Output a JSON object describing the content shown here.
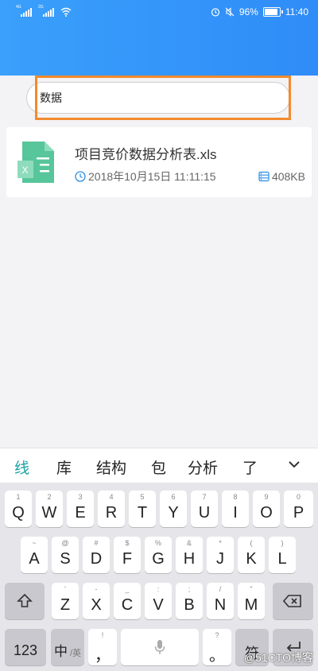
{
  "status_bar": {
    "net1": "4G",
    "net2": "2G",
    "battery": "96%",
    "time": "11:40"
  },
  "search": {
    "value": "数据"
  },
  "result": {
    "file_name": "项目竞价数据分析表.xls",
    "date": "2018年10月15日 11:11:15",
    "size": "408KB",
    "icon": "xls-file-icon"
  },
  "candidates": [
    "线",
    "库",
    "结构",
    "包",
    "分析",
    "了"
  ],
  "keyboard": {
    "row1": [
      {
        "main": "Q",
        "sub": "1"
      },
      {
        "main": "W",
        "sub": "2"
      },
      {
        "main": "E",
        "sub": "3"
      },
      {
        "main": "R",
        "sub": "4"
      },
      {
        "main": "T",
        "sub": "5"
      },
      {
        "main": "Y",
        "sub": "6"
      },
      {
        "main": "U",
        "sub": "7"
      },
      {
        "main": "I",
        "sub": "8"
      },
      {
        "main": "O",
        "sub": "9"
      },
      {
        "main": "P",
        "sub": "0"
      }
    ],
    "row2": [
      {
        "main": "A",
        "sub": "~"
      },
      {
        "main": "S",
        "sub": "@"
      },
      {
        "main": "D",
        "sub": "#"
      },
      {
        "main": "F",
        "sub": "$"
      },
      {
        "main": "G",
        "sub": "%"
      },
      {
        "main": "H",
        "sub": "&"
      },
      {
        "main": "J",
        "sub": "*"
      },
      {
        "main": "K",
        "sub": "("
      },
      {
        "main": "L",
        "sub": ")"
      }
    ],
    "row3": [
      {
        "main": "Z",
        "sub": "'"
      },
      {
        "main": "X",
        "sub": "-"
      },
      {
        "main": "C",
        "sub": "_"
      },
      {
        "main": "V",
        "sub": ":"
      },
      {
        "main": "B",
        "sub": ";"
      },
      {
        "main": "N",
        "sub": "/"
      },
      {
        "main": "M",
        "sub": "\""
      }
    ],
    "num_label": "123",
    "lang_main": "中",
    "lang_sub": "/英",
    "comma_main": "，",
    "comma_sub": "!",
    "period_main": "。",
    "period_sub": "?",
    "symbol_label": "符"
  },
  "watermark": "@51CTO博客"
}
